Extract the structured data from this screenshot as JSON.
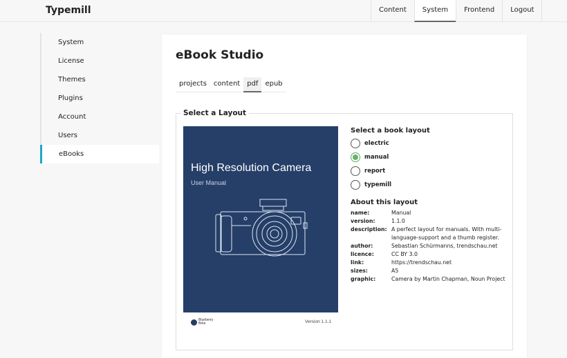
{
  "app": {
    "name": "Typemill"
  },
  "topnav": [
    "Content",
    "System",
    "Frontend",
    "Logout"
  ],
  "sidebar": [
    "System",
    "License",
    "Themes",
    "Plugins",
    "Account",
    "Users",
    "eBooks"
  ],
  "main": {
    "title": "eBook Studio",
    "tabs": [
      "projects",
      "content",
      "pdf",
      "epub"
    ],
    "layout_section_title": "Select a Layout",
    "cover": {
      "title": "High Resolution Camera",
      "subtitle": "User Manual",
      "brand_line1": "Blueberry",
      "brand_line2": "Beta",
      "version": "Version 1.1.1"
    },
    "choose_title": "Select a book layout",
    "layouts": [
      "electric",
      "manual",
      "report",
      "typemill"
    ],
    "selected_layout": "manual",
    "about_title": "About this layout",
    "about": [
      {
        "key": "name:",
        "value": "Manual"
      },
      {
        "key": "version:",
        "value": "1.1.0"
      },
      {
        "key": "description:",
        "value": "A perfect layout for manuals. With multi-language-support and a thumb register."
      },
      {
        "key": "author:",
        "value": "Sebastian Schürmanns, trendschau.net"
      },
      {
        "key": "licence:",
        "value": "CC BY 3.0"
      },
      {
        "key": "link:",
        "value": "https://trendschau.net"
      },
      {
        "key": "sizes:",
        "value": "A5"
      },
      {
        "key": "graphic:",
        "value": "Camera by Martin Chapman, Noun Project"
      }
    ]
  },
  "colors": {
    "accent": "#20a5c9",
    "cover_bg": "#253f68",
    "radio_selected": "#66b366"
  }
}
